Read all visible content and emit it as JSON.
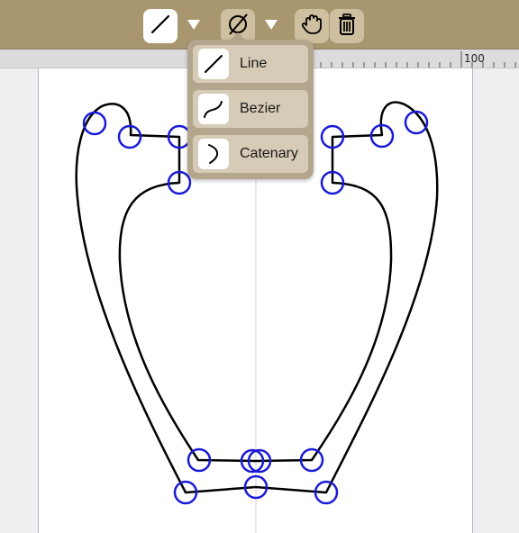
{
  "toolbar": {
    "line_tool": {
      "icon": "line-icon"
    },
    "dropdown_1": {
      "icon": "chevron-down-icon"
    },
    "fill_tool": {
      "icon": "no-fill-icon"
    },
    "dropdown_2": {
      "icon": "chevron-down-icon"
    },
    "hand_tool": {
      "icon": "hand-icon"
    },
    "delete_tool": {
      "icon": "trash-icon"
    }
  },
  "ruler": {
    "label": "100"
  },
  "line_type_menu": {
    "items": [
      {
        "label": "Line",
        "icon": "line-icon"
      },
      {
        "label": "Bezier",
        "icon": "bezier-curve-icon"
      },
      {
        "label": "Catenary",
        "icon": "catenary-curve-icon"
      }
    ]
  },
  "colors": {
    "toolbar": "#a8966f",
    "menu_background": "#b3a68d",
    "menu_item": "#d6cbb6",
    "handle": "#1a1ad6",
    "stroke": "#000000"
  }
}
